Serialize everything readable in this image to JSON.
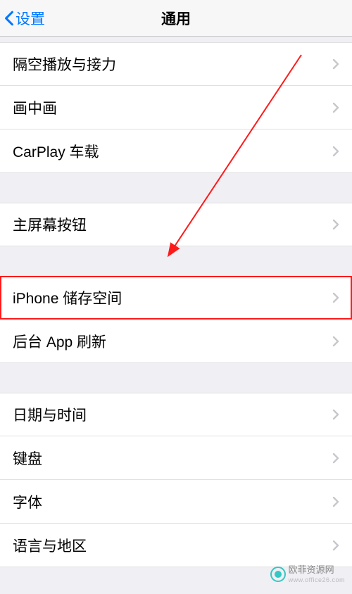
{
  "navbar": {
    "back_label": "设置",
    "title": "通用"
  },
  "groups": [
    {
      "items": [
        {
          "label": "隔空播放与接力",
          "key": "airplay-handoff"
        },
        {
          "label": "画中画",
          "key": "pip"
        },
        {
          "label": "CarPlay 车载",
          "key": "carplay"
        }
      ]
    },
    {
      "items": [
        {
          "label": "主屏幕按钮",
          "key": "home-button"
        }
      ]
    },
    {
      "items": [
        {
          "label": "iPhone 储存空间",
          "key": "iphone-storage",
          "highlighted": true
        },
        {
          "label": "后台 App 刷新",
          "key": "background-refresh"
        }
      ]
    },
    {
      "items": [
        {
          "label": "日期与时间",
          "key": "date-time"
        },
        {
          "label": "键盘",
          "key": "keyboard"
        },
        {
          "label": "字体",
          "key": "fonts"
        },
        {
          "label": "语言与地区",
          "key": "language-region"
        }
      ]
    }
  ],
  "annotation": {
    "arrow_color": "#ff1a1a",
    "highlight_row_key": "iphone-storage"
  },
  "watermark": {
    "cn": "欧菲资源网",
    "en": "www.office26.com"
  }
}
